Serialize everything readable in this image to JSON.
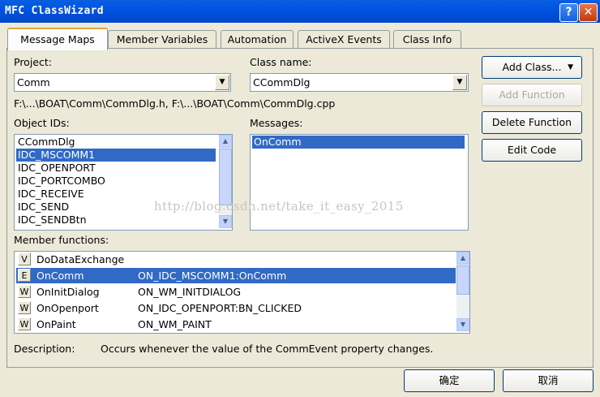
{
  "window": {
    "title": "MFC ClassWizard",
    "help_glyph": "?",
    "close_glyph": "✕"
  },
  "tabs": [
    {
      "label": "Message Maps",
      "active": true
    },
    {
      "label": "Member Variables"
    },
    {
      "label": "Automation"
    },
    {
      "label": "ActiveX Events"
    },
    {
      "label": "Class Info"
    }
  ],
  "project": {
    "label": "Project:",
    "value": "Comm"
  },
  "class_name": {
    "label": "Class name:",
    "value": "CCommDlg"
  },
  "file_paths": "F:\\...\\BOAT\\Comm\\CommDlg.h, F:\\...\\BOAT\\Comm\\CommDlg.cpp",
  "object_ids": {
    "label": "Object IDs:",
    "items": [
      "CCommDlg",
      "IDC_MSCOMM1",
      "IDC_OPENPORT",
      "IDC_PORTCOMBO",
      "IDC_RECEIVE",
      "IDC_SEND",
      "IDC_SENDBtn"
    ],
    "selected": "IDC_MSCOMM1"
  },
  "messages": {
    "label": "Messages:",
    "items": [
      "OnComm"
    ],
    "selected": "OnComm"
  },
  "member_functions": {
    "label": "Member functions:",
    "rows": [
      {
        "type": "V",
        "name": "DoDataExchange",
        "map": ""
      },
      {
        "type": "E",
        "name": "OnComm",
        "map": "ON_IDC_MSCOMM1:OnComm",
        "selected": true
      },
      {
        "type": "W",
        "name": "OnInitDialog",
        "map": "ON_WM_INITDIALOG"
      },
      {
        "type": "W",
        "name": "OnOpenport",
        "map": "ON_IDC_OPENPORT:BN_CLICKED"
      },
      {
        "type": "W",
        "name": "OnPaint",
        "map": "ON_WM_PAINT"
      }
    ]
  },
  "description": {
    "label": "Description:",
    "text": "Occurs whenever the value of the CommEvent property changes."
  },
  "buttons": {
    "add_class": "Add Class...",
    "add_function": "Add Function",
    "delete_function": "Delete Function",
    "edit_code": "Edit Code",
    "ok": "确定",
    "cancel": "取消"
  },
  "watermark": "http://blog.csdn.net/take_it_easy_2015",
  "colors": {
    "title_bar": "#0054e3",
    "selection": "#316ac5",
    "face": "#ece9d8",
    "active_tab_accent": "#e8a33d"
  }
}
